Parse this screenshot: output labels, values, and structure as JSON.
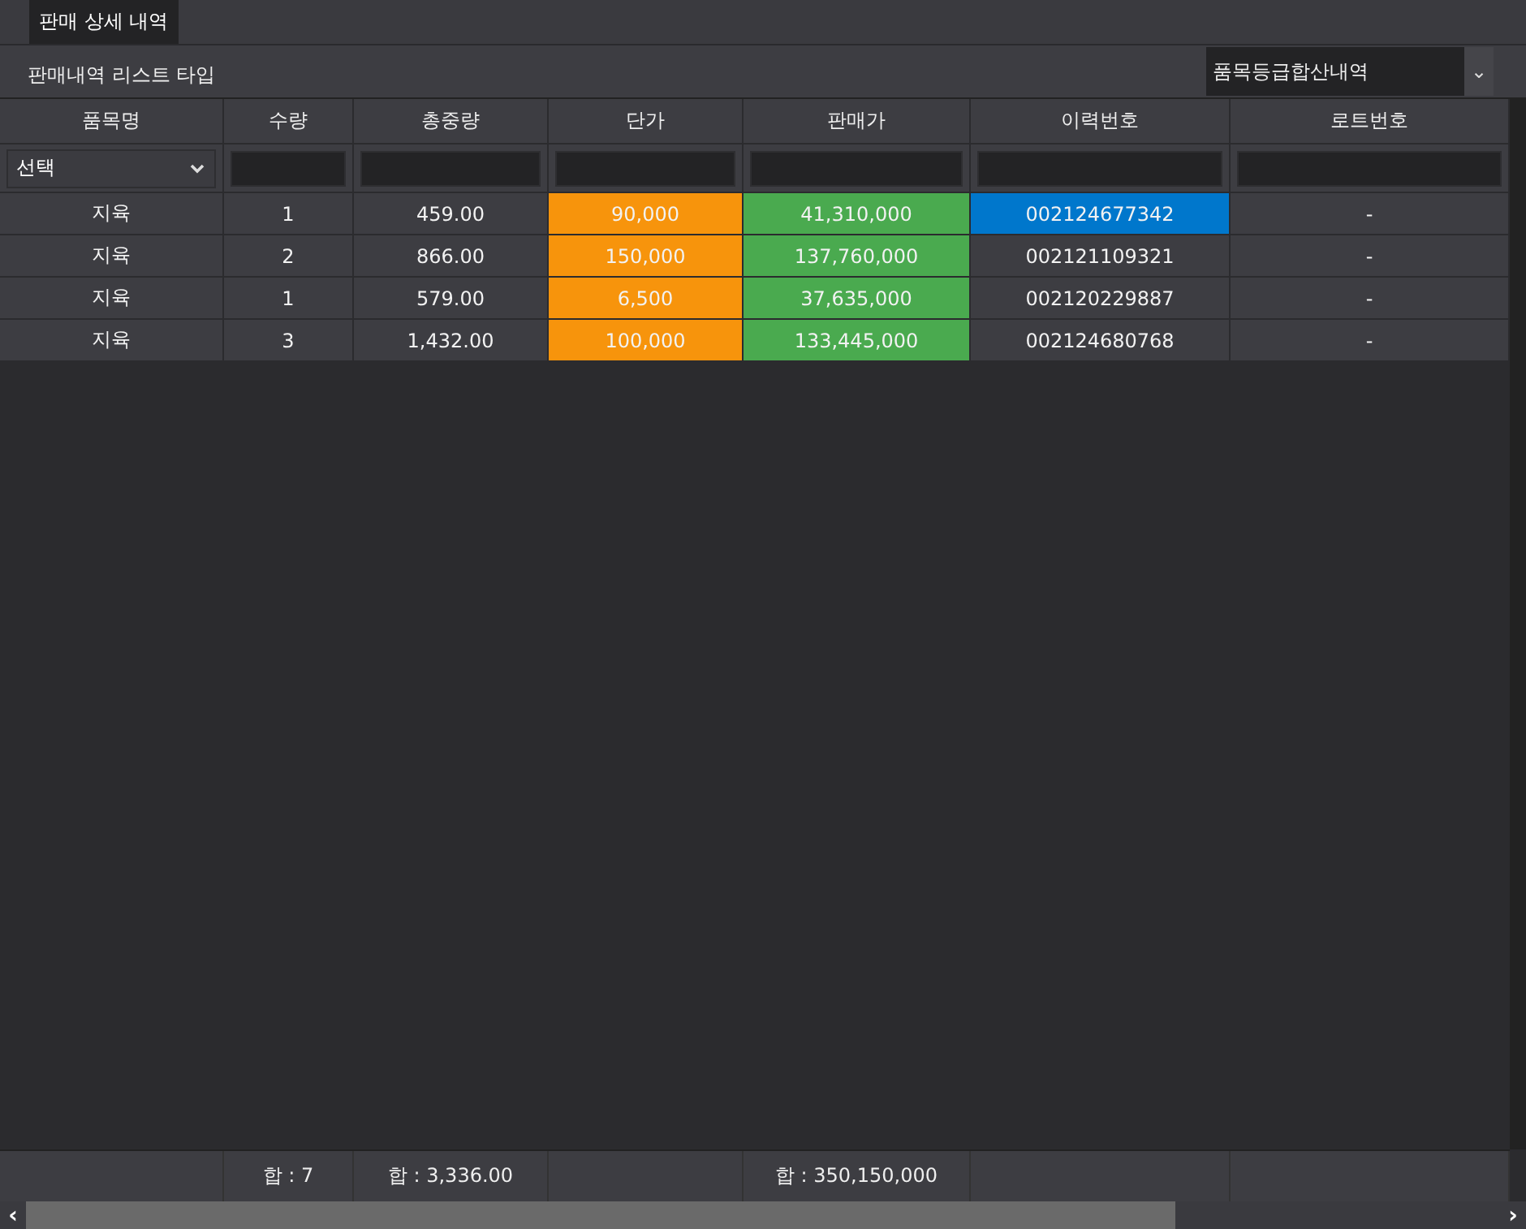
{
  "tabs": [
    {
      "label": "판매 상세 내역",
      "selected": true
    }
  ],
  "toolbar": {
    "label": "판매내역 리스트 타입",
    "dropdown": {
      "value": "품목등급합산내역",
      "caret": "⌄"
    }
  },
  "table": {
    "columns": [
      {
        "label": "품목명",
        "filter": {
          "kind": "select",
          "value": "선택"
        }
      },
      {
        "label": "수량",
        "filter": {
          "kind": "text"
        },
        "total": "합 : 7"
      },
      {
        "label": "총중량",
        "filter": {
          "kind": "text"
        },
        "total": "합 : 3,336.00"
      },
      {
        "label": "단가",
        "filter": {
          "kind": "text"
        },
        "color": "#f7940c"
      },
      {
        "label": "판매가",
        "filter": {
          "kind": "text"
        },
        "color": "#4aaa4f",
        "total": "합 : 350,150,000"
      },
      {
        "label": "이력번호",
        "filter": {
          "kind": "text"
        }
      },
      {
        "label": "로트번호",
        "filter": {
          "kind": "text"
        }
      }
    ],
    "rows": [
      {
        "cells": [
          {
            "text": "지육",
            "selected": false
          },
          {
            "text": "1",
            "selected": false
          },
          {
            "text": "459.00",
            "selected": false
          },
          {
            "text": "90,000",
            "selected": false
          },
          {
            "text": "41,310,000",
            "selected": false
          },
          {
            "text": "002124677342",
            "selected": true
          },
          {
            "text": "-",
            "selected": false
          }
        ]
      },
      {
        "cells": [
          {
            "text": "지육",
            "selected": false
          },
          {
            "text": "2",
            "selected": false
          },
          {
            "text": "866.00",
            "selected": false
          },
          {
            "text": "150,000",
            "selected": false
          },
          {
            "text": "137,760,000",
            "selected": false
          },
          {
            "text": "002121109321",
            "selected": false
          },
          {
            "text": "-",
            "selected": false
          }
        ]
      },
      {
        "cells": [
          {
            "text": "지육",
            "selected": false
          },
          {
            "text": "1",
            "selected": false
          },
          {
            "text": "579.00",
            "selected": false
          },
          {
            "text": "6,500",
            "selected": false
          },
          {
            "text": "37,635,000",
            "selected": false
          },
          {
            "text": "002120229887",
            "selected": false
          },
          {
            "text": "-",
            "selected": false
          }
        ]
      },
      {
        "cells": [
          {
            "text": "지육",
            "selected": false
          },
          {
            "text": "3",
            "selected": false
          },
          {
            "text": "1,432.00",
            "selected": false
          },
          {
            "text": "100,000",
            "selected": false
          },
          {
            "text": "133,445,000",
            "selected": false
          },
          {
            "text": "002124680768",
            "selected": false
          },
          {
            "text": "-",
            "selected": false
          }
        ]
      }
    ]
  },
  "scrollbar": {
    "left": "‹",
    "right": "›"
  }
}
